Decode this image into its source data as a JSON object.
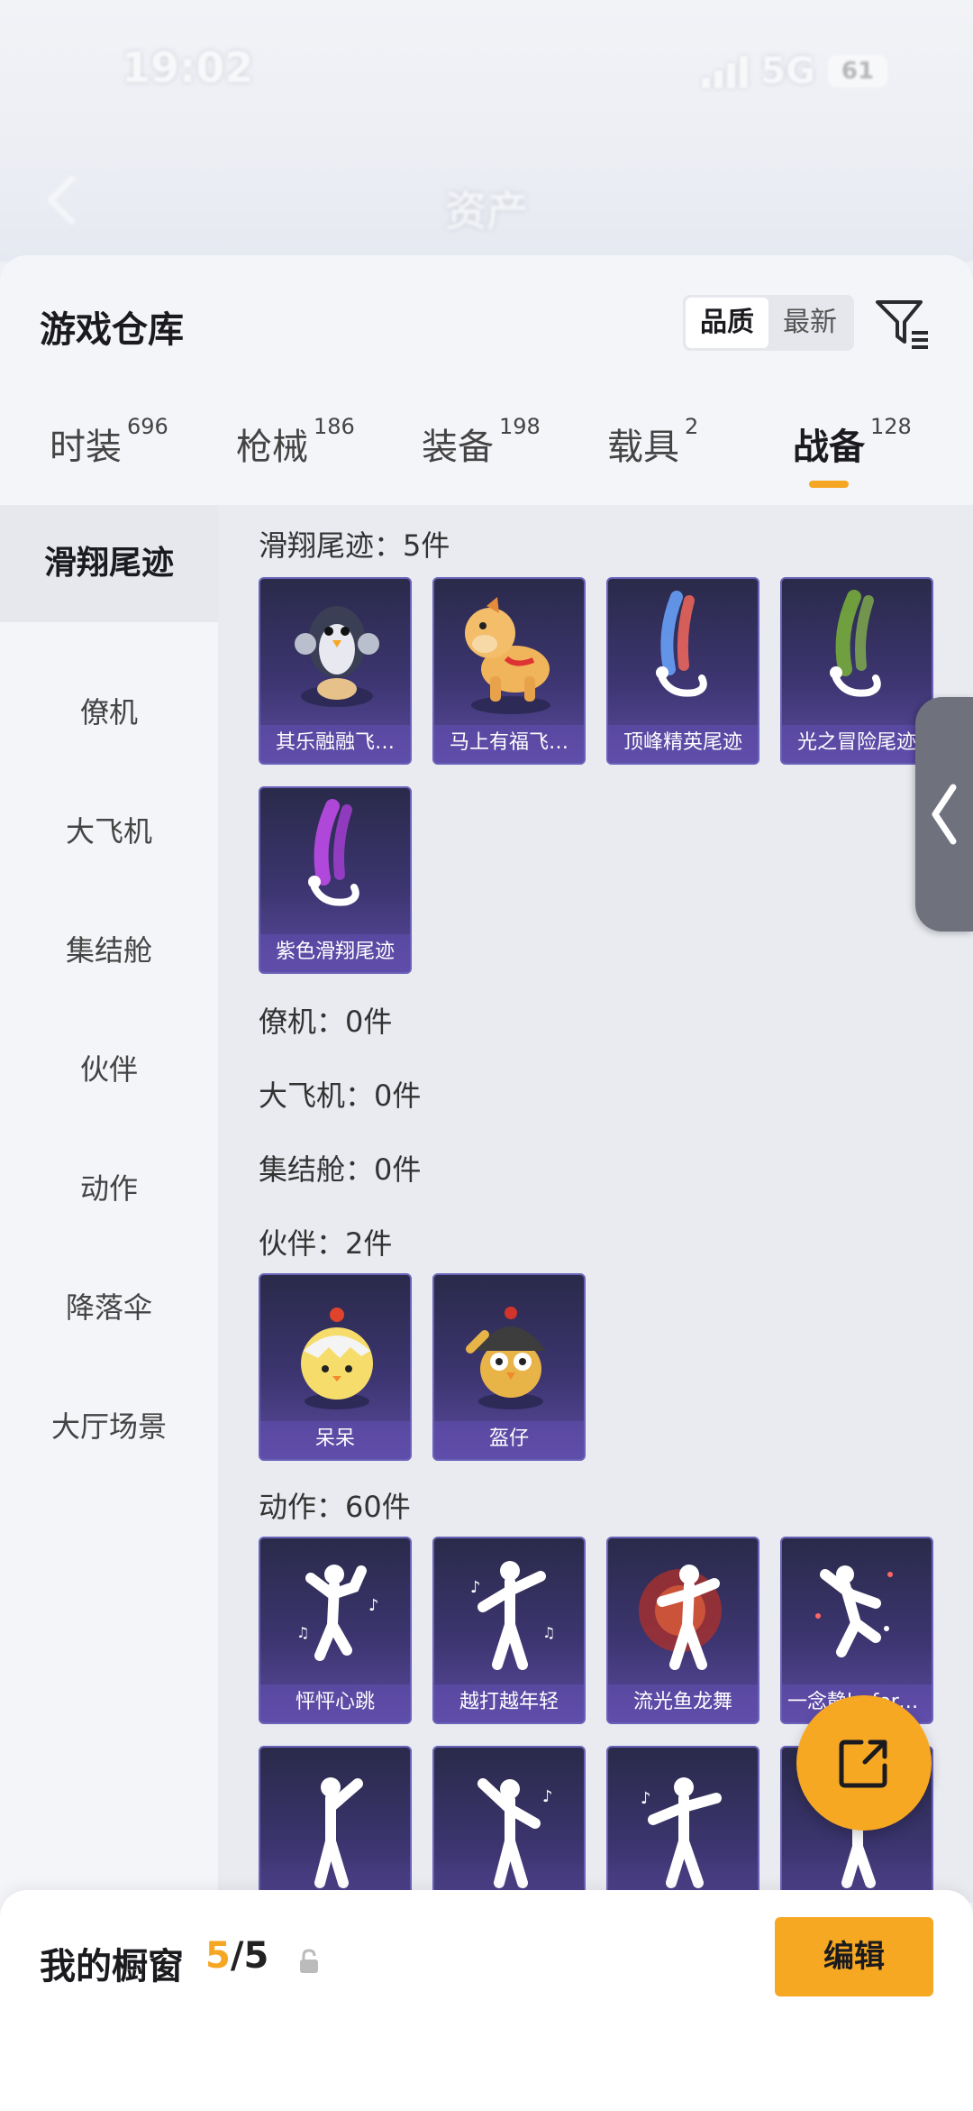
{
  "status_bar": {
    "time": "19:02",
    "network": "5G",
    "battery": "61"
  },
  "header": {
    "title": "资产"
  },
  "panel": {
    "title": "游戏仓库",
    "sort": {
      "options": [
        "品质",
        "最新"
      ],
      "active": "品质"
    }
  },
  "tabs": [
    {
      "label": "时装",
      "count": "696"
    },
    {
      "label": "枪械",
      "count": "186"
    },
    {
      "label": "装备",
      "count": "198"
    },
    {
      "label": "载具",
      "count": "2"
    },
    {
      "label": "战备",
      "count": "128"
    }
  ],
  "active_tab": "战备",
  "sidebar": {
    "items": [
      "滑翔尾迹",
      "僚机",
      "大飞机",
      "集结舱",
      "伙伴",
      "动作",
      "降落伞",
      "大厅场景"
    ]
  },
  "sections": {
    "glide_trail": {
      "label": "滑翔尾迹：5件",
      "items": [
        "其乐融融飞…",
        "马上有福飞…",
        "顶峰精英尾迹",
        "光之冒险尾迹",
        "紫色滑翔尾迹"
      ]
    },
    "wingman": {
      "label": "僚机：0件"
    },
    "big_plane": {
      "label": "大飞机：0件"
    },
    "assembly_pod": {
      "label": "集结舱：0件"
    },
    "companion": {
      "label": "伙伴：2件",
      "items": [
        "呆呆",
        "盔仔"
      ]
    },
    "emote": {
      "label": "动作：60件",
      "items": [
        "怦怦心跳",
        "越打越年轻",
        "流光鱼龙舞",
        "一念静beforeAll"
      ]
    }
  },
  "bottom": {
    "showcase_title": "我的橱窗",
    "showcase_current": "5",
    "showcase_total": "/5",
    "edit_label": "编辑"
  },
  "colors": {
    "accent": "#f7a823",
    "card_top": "#2a2a4a",
    "card_bottom": "#5b4a9f"
  }
}
